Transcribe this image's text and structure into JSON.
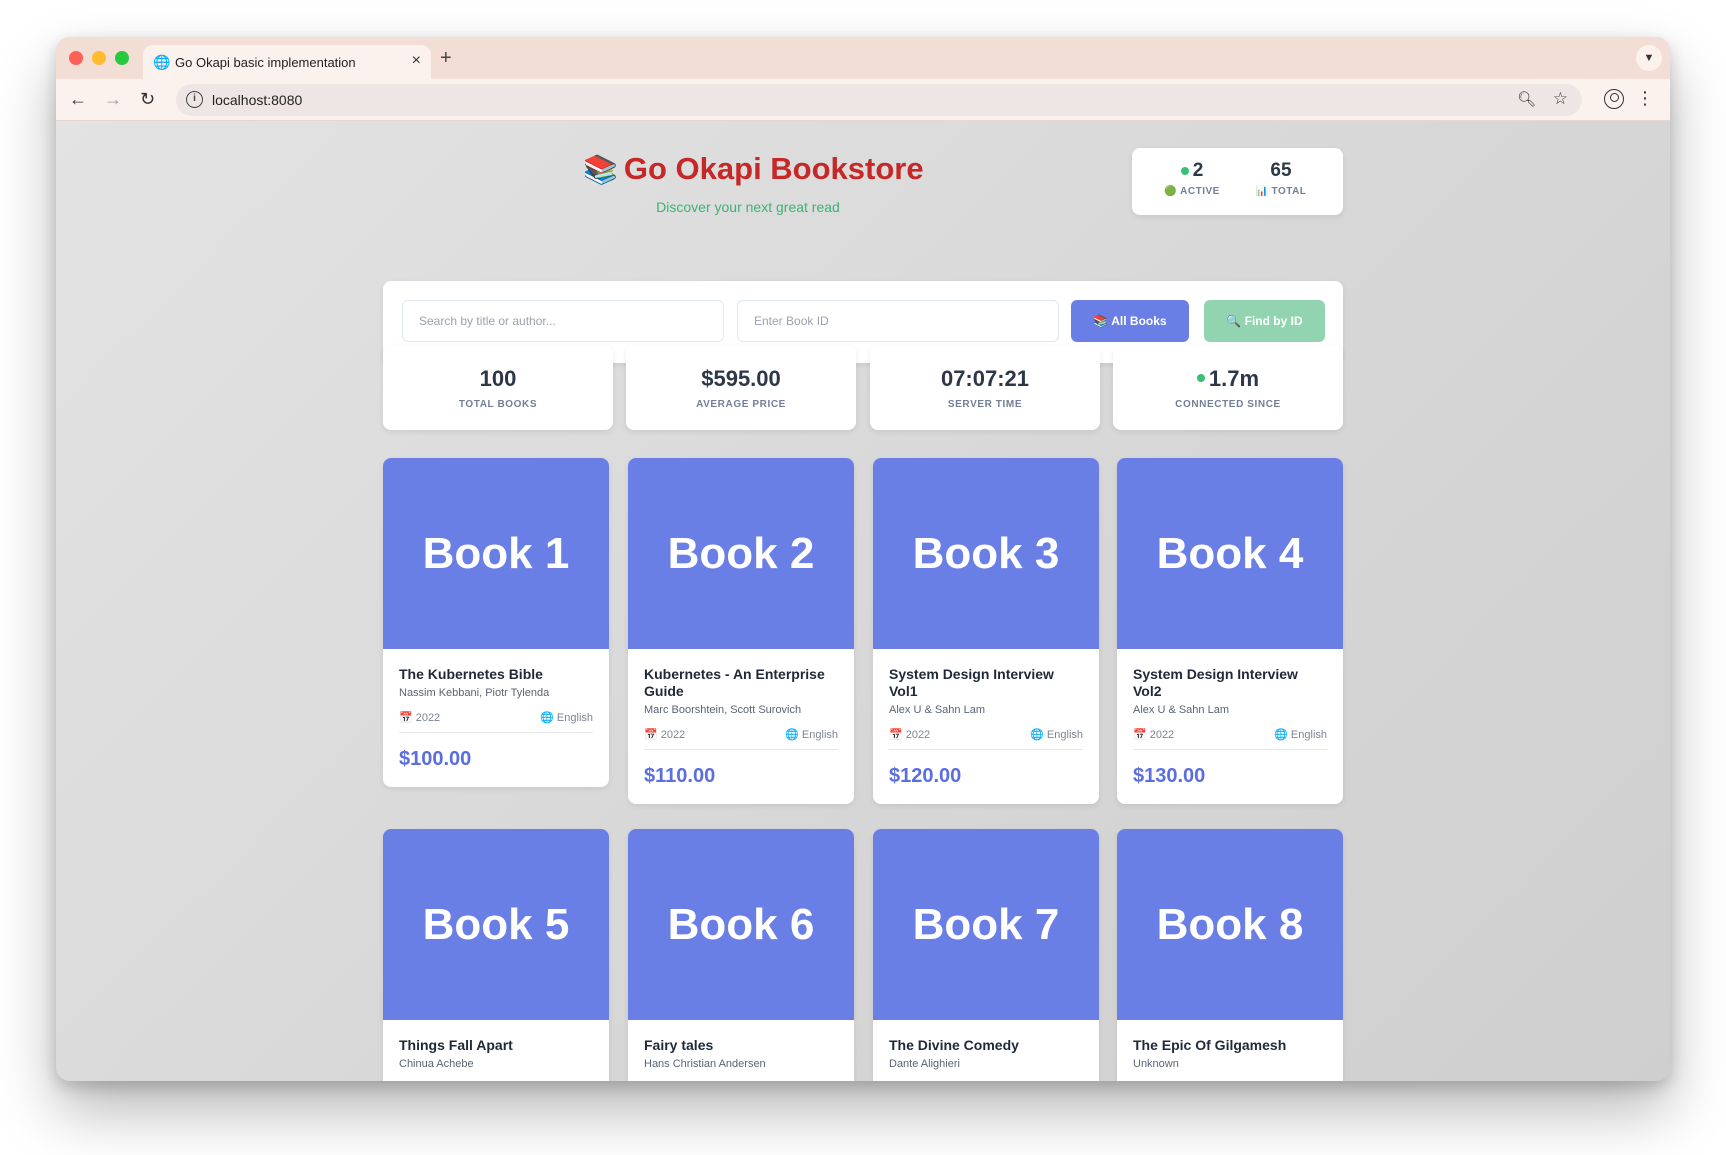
{
  "browser": {
    "tab_title": "Go Okapi basic implementation",
    "url": "localhost:8080"
  },
  "header": {
    "title": "Go Okapi Bookstore",
    "title_emoji": "📚",
    "subtitle": "Discover your next great read"
  },
  "connections": {
    "active_value": "2",
    "active_label": "ACTIVE",
    "total_value": "65",
    "total_label": "TOTAL"
  },
  "search": {
    "search_placeholder": "Search by title or author...",
    "id_placeholder": "Enter Book ID",
    "all_books_label": "📚 All Books",
    "find_by_id_label": "🔍 Find by ID"
  },
  "stats": [
    {
      "value": "100",
      "label": "TOTAL BOOKS"
    },
    {
      "value": "$595.00",
      "label": "AVERAGE PRICE"
    },
    {
      "value": "07:07:21",
      "label": "SERVER TIME"
    },
    {
      "value": "1.7m",
      "label": "CONNECTED SINCE"
    }
  ],
  "books": [
    {
      "cover": "Book 1",
      "title": "The Kubernetes Bible",
      "author": "Nassim Kebbani, Piotr Tylenda",
      "year": "2022",
      "language": "English",
      "price": "$100.00"
    },
    {
      "cover": "Book 2",
      "title": "Kubernetes - An Enterprise Guide",
      "author": "Marc Boorshtein, Scott Surovich",
      "year": "2022",
      "language": "English",
      "price": "$110.00"
    },
    {
      "cover": "Book 3",
      "title": "System Design Interview Vol1",
      "author": "Alex U & Sahn Lam",
      "year": "2022",
      "language": "English",
      "price": "$120.00"
    },
    {
      "cover": "Book 4",
      "title": "System Design Interview Vol2",
      "author": "Alex U & Sahn Lam",
      "year": "2022",
      "language": "English",
      "price": "$130.00"
    },
    {
      "cover": "Book 5",
      "title": "Things Fall Apart",
      "author": "Chinua Achebe"
    },
    {
      "cover": "Book 6",
      "title": "Fairy tales",
      "author": "Hans Christian Andersen"
    },
    {
      "cover": "Book 7",
      "title": "The Divine Comedy",
      "author": "Dante Alighieri"
    },
    {
      "cover": "Book 8",
      "title": "The Epic Of Gilgamesh",
      "author": "Unknown"
    }
  ],
  "colors": {
    "accent": "#6a7fe6",
    "title_red": "#c62828",
    "subtitle_green": "#3cb371",
    "price": "#5b6ee0",
    "find_button": "#93d4b0"
  }
}
